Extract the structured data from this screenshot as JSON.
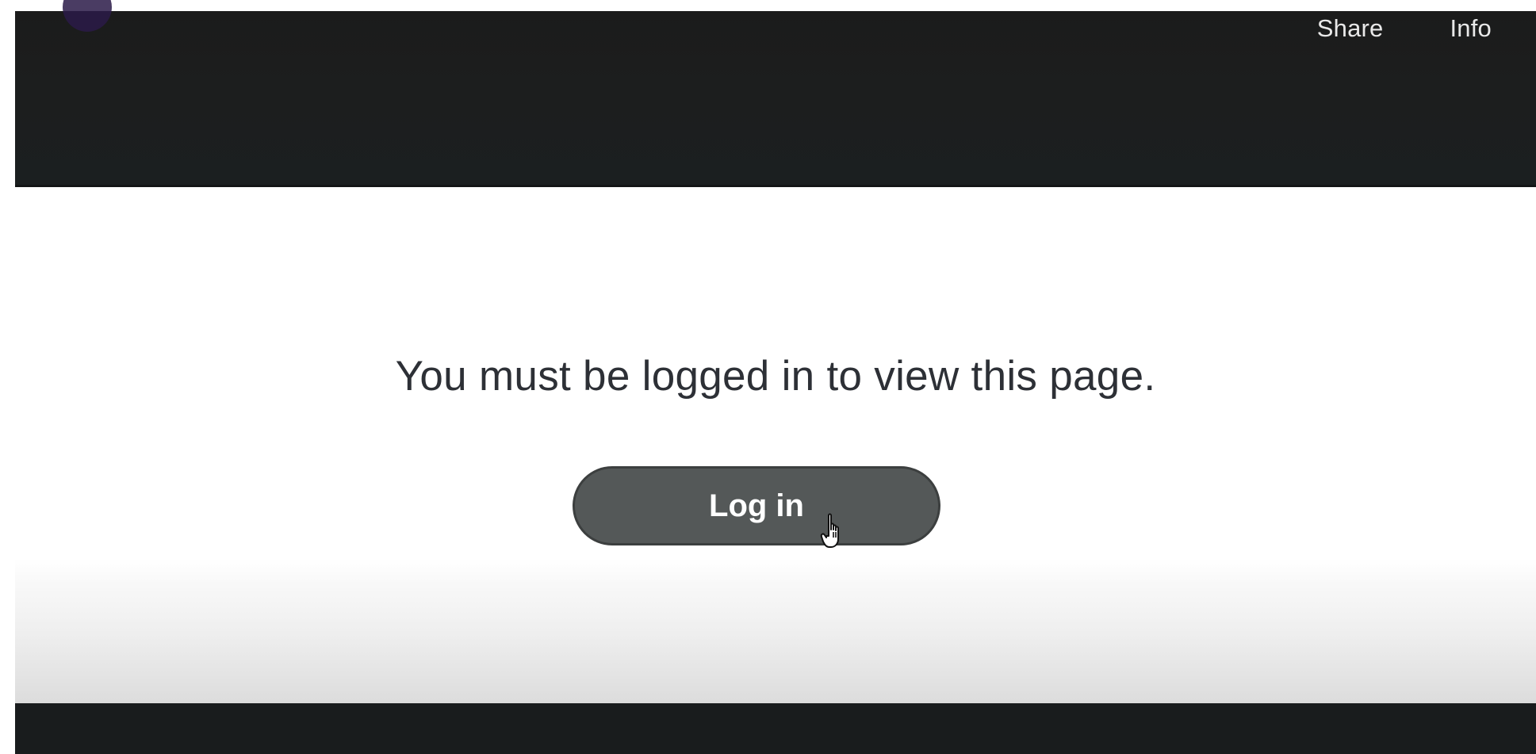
{
  "header": {
    "nav": {
      "share_label": "Share",
      "info_label": "Info"
    }
  },
  "main": {
    "message": "You must be logged in to view this page.",
    "login_label": "Log in"
  },
  "icons": {
    "cursor": "hand-pointer-icon",
    "logo": "logo-icon"
  },
  "colors": {
    "header_bg": "#1b1b1b",
    "button_bg": "#545858",
    "footer_bg": "#191c1d"
  }
}
